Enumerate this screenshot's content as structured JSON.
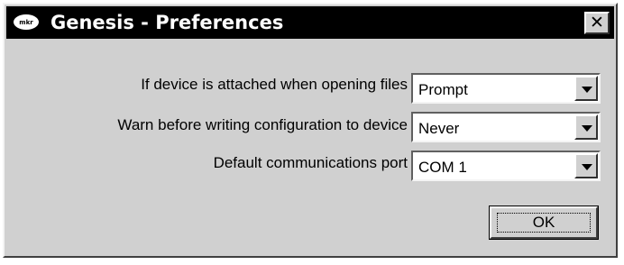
{
  "window": {
    "title": "Genesis - Preferences",
    "app_icon_text": "mkr",
    "close_label": "✕"
  },
  "settings": [
    {
      "label": "If device is attached when opening files",
      "value": "Prompt"
    },
    {
      "label": "Warn before writing configuration to device",
      "value": "Never"
    },
    {
      "label": "Default communications port",
      "value": "COM 1"
    }
  ],
  "buttons": {
    "ok_label": "OK"
  },
  "colors": {
    "titlebar": "#000000",
    "dialog_bg": "#d0d0d0",
    "field_bg": "#ffffff"
  },
  "icons": {
    "app": "app-logo-icon",
    "close": "close-icon",
    "dropdown": "chevron-down-icon"
  }
}
